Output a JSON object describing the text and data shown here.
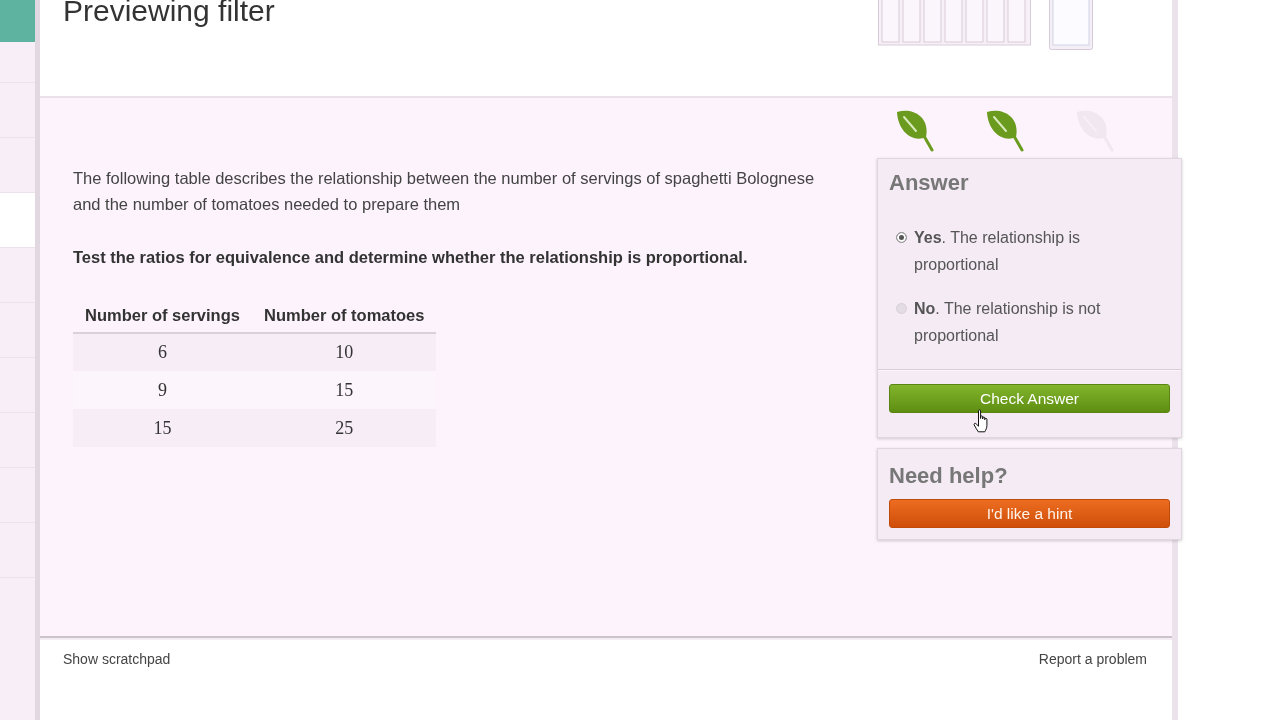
{
  "header": {
    "title": "Previewing filter"
  },
  "streak": [
    {
      "earned": true
    },
    {
      "earned": true
    },
    {
      "earned": false
    }
  ],
  "question": {
    "text": "The following table describes the relationship between the number of servings of spaghetti Bolognese and the number of tomatoes needed to prepare them",
    "instruction": "Test the ratios for equivalence and determine whether the relationship is proportional."
  },
  "table": {
    "columns": [
      "Number of servings",
      "Number of tomatoes"
    ],
    "rows": [
      [
        "6",
        "10"
      ],
      [
        "9",
        "15"
      ],
      [
        "15",
        "25"
      ]
    ]
  },
  "answer_panel": {
    "title": "Answer",
    "choices": [
      {
        "label": "**Yes**. The relationship is proportional",
        "selected": true
      },
      {
        "label": "**No**. The relationship is not proportional",
        "selected": false
      }
    ],
    "button": "Check Answer"
  },
  "help_panel": {
    "title": "Need help?",
    "button": "I'd like a hint"
  },
  "footer": {
    "left_link": "Show scratchpad",
    "right_link": "Report a problem"
  }
}
